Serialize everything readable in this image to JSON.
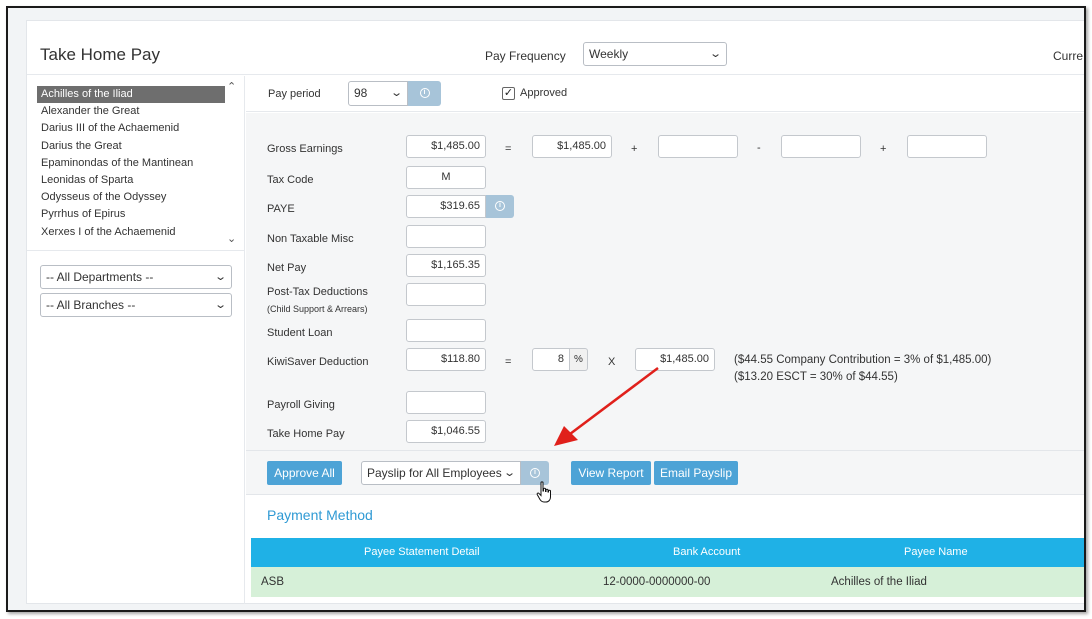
{
  "header": {
    "title": "Take Home Pay",
    "pay_frequency_label": "Pay Frequency",
    "pay_frequency_value": "Weekly",
    "currency_label": "Curre"
  },
  "employees": [
    "Achilles of the Iliad",
    "Alexander the Great",
    "Darius III of the Achaemenid",
    "Darius the Great",
    "Epaminondas of the Mantinean",
    "Leonidas of Sparta",
    "Odysseus of the Odyssey",
    "Pyrrhus of Epirus",
    "Xerxes I of the Achaemenid"
  ],
  "selected_employee": "Achilles of the Iliad",
  "filters": {
    "departments": "-- All Departments --",
    "branches": "-- All Branches --"
  },
  "pay_period": {
    "label": "Pay period",
    "value": "98",
    "approved_label": "Approved",
    "approved_checked": true
  },
  "form": {
    "gross_earnings": {
      "label": "Gross Earnings",
      "value": "$1,485.00",
      "calc": "$1,485.00",
      "op_eq": "=",
      "op_plus": "+",
      "op_minus": "-",
      "op_plus2": "+"
    },
    "tax_code": {
      "label": "Tax Code",
      "value": "M"
    },
    "paye": {
      "label": "PAYE",
      "value": "$319.65"
    },
    "non_taxable_misc": {
      "label": "Non Taxable Misc",
      "value": ""
    },
    "net_pay": {
      "label": "Net Pay",
      "value": "$1,165.35"
    },
    "post_tax_deductions": {
      "label": "Post-Tax Deductions",
      "sublabel": "(Child Support & Arrears)",
      "value": ""
    },
    "student_loan": {
      "label": "Student Loan",
      "value": ""
    },
    "kiwisaver": {
      "label": "KiwiSaver Deduction",
      "value": "$118.80",
      "op_eq": "=",
      "rate": "8",
      "rate_suffix": "%",
      "op_x": "X",
      "base": "$1,485.00",
      "note1": "($44.55 Company Contribution = 3% of $1,485.00)",
      "note2": "($13.20 ESCT = 30% of $44.55)"
    },
    "payroll_giving": {
      "label": "Payroll Giving",
      "value": ""
    },
    "take_home_pay": {
      "label": "Take Home Pay",
      "value": "$1,046.55"
    }
  },
  "actions": {
    "approve_all": "Approve All",
    "payslip_select": "Payslip for All Employees",
    "view_report": "View Report",
    "email_payslip": "Email Payslip"
  },
  "payment_method": {
    "title": "Payment Method",
    "columns": [
      "Payee Statement Detail",
      "Bank Account",
      "Payee Name"
    ],
    "rows": [
      [
        "ASB",
        "12-0000-0000000-00",
        "Achilles of the Iliad"
      ]
    ]
  },
  "colors": {
    "accent": "#4da3d6",
    "table_header": "#1fb1e6",
    "row_highlight": "#d6f0d8",
    "annotation_arrow": "#e0201b"
  },
  "icons": {
    "info": "info-circle-icon",
    "chevron": "chevron-down-icon",
    "cursor": "hand-pointer-icon"
  }
}
